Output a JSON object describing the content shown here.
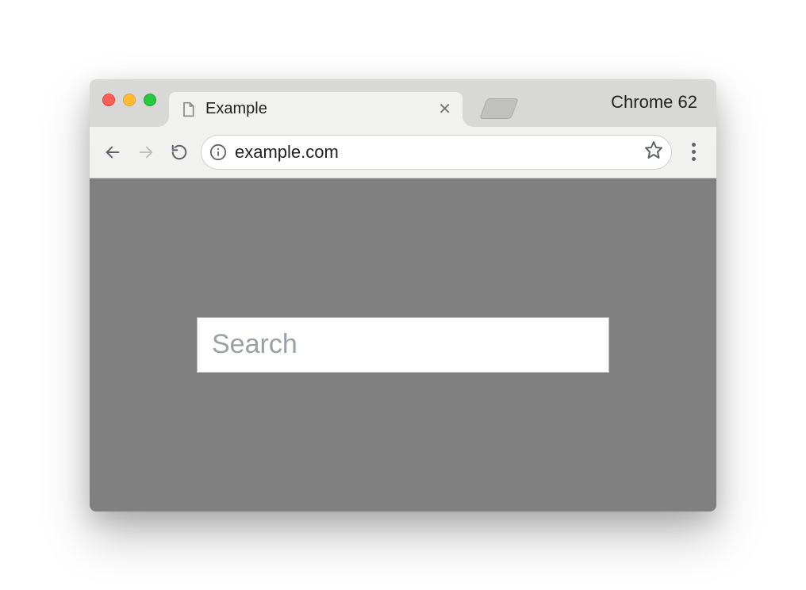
{
  "browser": {
    "label": "Chrome 62"
  },
  "tab": {
    "title": "Example"
  },
  "address": {
    "url": "example.com"
  },
  "page": {
    "search_placeholder": "Search",
    "search_value": ""
  }
}
